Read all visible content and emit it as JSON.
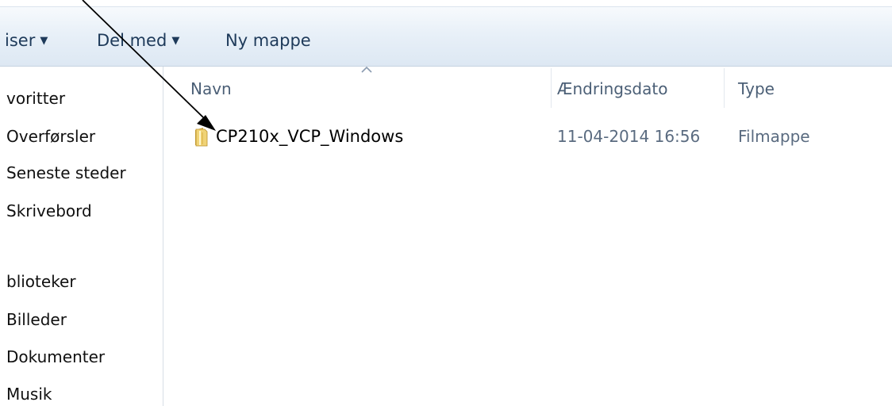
{
  "toolbar": {
    "organize_label": "iser",
    "share_label": "Del med",
    "new_folder_label": "Ny mappe"
  },
  "nav": {
    "items": [
      "voritter",
      "Overførsler",
      "Seneste steder",
      "Skrivebord",
      "blioteker",
      "Billeder",
      "Dokumenter",
      "Musik"
    ]
  },
  "columns": {
    "name": "Navn",
    "date": "Ændringsdato",
    "type": "Type"
  },
  "files": [
    {
      "name": "CP210x_VCP_Windows",
      "date": "11-04-2014 16:56",
      "type": "Filmappe",
      "icon": "folder-icon"
    }
  ],
  "colors": {
    "toolbar_text": "#1e3a5a",
    "header_text": "#4b5f76",
    "meta_text": "#5a6b80",
    "folder_yellow": "#e8c14d"
  }
}
